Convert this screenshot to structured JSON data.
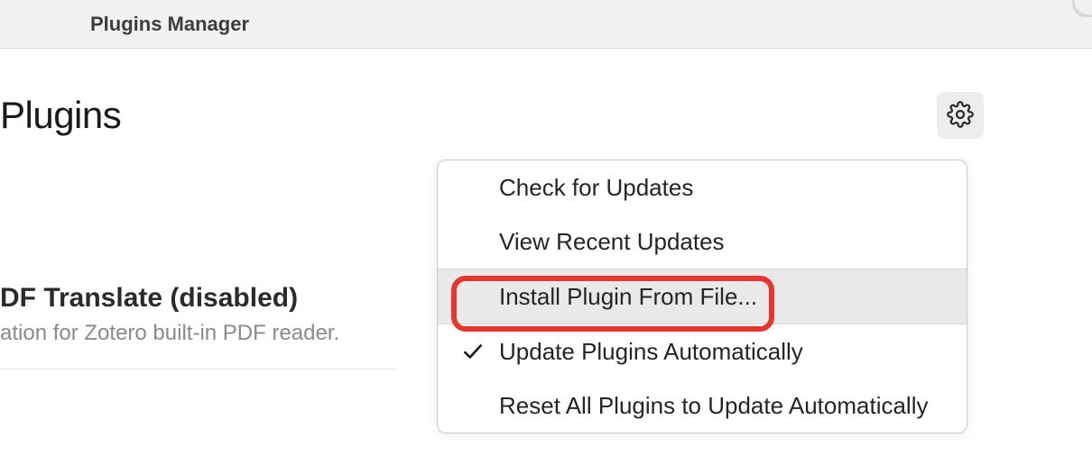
{
  "titlebar": {
    "title": "Plugins Manager"
  },
  "header": {
    "page_title": "Plugins"
  },
  "plugin": {
    "name": "DF Translate (disabled)",
    "description": "ation for Zotero built-in PDF reader."
  },
  "dropdown": {
    "items": [
      {
        "label": "Check for Updates",
        "checked": false
      },
      {
        "label": "View Recent Updates",
        "checked": false
      },
      {
        "label": "Install Plugin From File...",
        "checked": false,
        "highlighted": true
      },
      {
        "label": "Update Plugins Automatically",
        "checked": true
      },
      {
        "label": "Reset All Plugins to Update Automatically",
        "checked": false
      }
    ]
  }
}
